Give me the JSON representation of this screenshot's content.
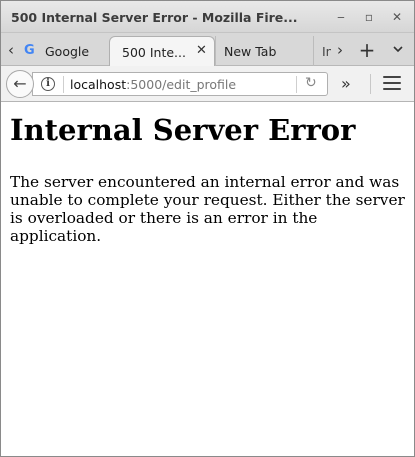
{
  "window": {
    "title": "500 Internal Server Error - Mozilla Fire...",
    "controls": {
      "minimize": "‒",
      "maximize": "▫",
      "close": "✕"
    }
  },
  "tabs": [
    {
      "label": "Google",
      "icon": "google-favicon"
    },
    {
      "label": "500 Inte...",
      "active": true,
      "close": "✕"
    },
    {
      "label": "New Tab"
    },
    {
      "label": "In"
    }
  ],
  "tabstrip": {
    "scroll_left": "‹",
    "scroll_right": "›",
    "new_tab": "+",
    "list_all": "⌄"
  },
  "navbar": {
    "back": "←",
    "info": "i",
    "url_host": "localhost",
    "url_path": ":5000/edit_profile",
    "reload": "↻",
    "overflow": "»"
  },
  "page": {
    "heading": "Internal Server Error",
    "message": "The server encountered an internal error and was unable to complete your request. Either the server is overloaded or there is an error in the application."
  }
}
